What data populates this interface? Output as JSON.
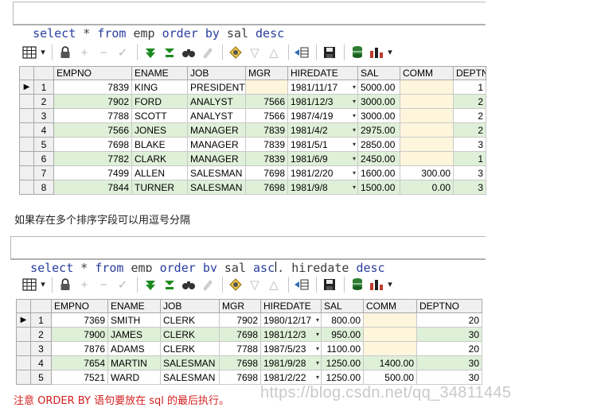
{
  "query1": {
    "tokens": [
      "select",
      "*",
      "from",
      "emp",
      "order",
      "by",
      "sal",
      "desc"
    ]
  },
  "toolbar": {
    "grid_icon": "grid-icon",
    "dropdown_arrow": "▾",
    "icons": [
      "lock-icon",
      "add-row-icon",
      "delete-row-icon",
      "post-edit-icon",
      "filter-icon",
      "filter-clear-icon",
      "find-icon",
      "clear-icon",
      "query-by-example-icon",
      "sort-desc-icon",
      "sort-asc-icon",
      "export-icon",
      "save-icon",
      "db-icon",
      "chart-icon"
    ]
  },
  "grid1": {
    "columns": [
      "EMPNO",
      "ENAME",
      "JOB",
      "MGR",
      "HIREDATE",
      "SAL",
      "COMM",
      "DEPTNO"
    ],
    "rows": [
      {
        "n": "1",
        "empno": "7839",
        "ename": "KING",
        "job": "PRESIDENT",
        "mgr": "",
        "hiredate": "1981/11/17",
        "sal": "5000.00",
        "comm": "",
        "deptno": "1"
      },
      {
        "n": "2",
        "empno": "7902",
        "ename": "FORD",
        "job": "ANALYST",
        "mgr": "7566",
        "hiredate": "1981/12/3",
        "sal": "3000.00",
        "comm": "",
        "deptno": "2"
      },
      {
        "n": "3",
        "empno": "7788",
        "ename": "SCOTT",
        "job": "ANALYST",
        "mgr": "7566",
        "hiredate": "1987/4/19",
        "sal": "3000.00",
        "comm": "",
        "deptno": "2"
      },
      {
        "n": "4",
        "empno": "7566",
        "ename": "JONES",
        "job": "MANAGER",
        "mgr": "7839",
        "hiredate": "1981/4/2",
        "sal": "2975.00",
        "comm": "",
        "deptno": "2"
      },
      {
        "n": "5",
        "empno": "7698",
        "ename": "BLAKE",
        "job": "MANAGER",
        "mgr": "7839",
        "hiredate": "1981/5/1",
        "sal": "2850.00",
        "comm": "",
        "deptno": "3"
      },
      {
        "n": "6",
        "empno": "7782",
        "ename": "CLARK",
        "job": "MANAGER",
        "mgr": "7839",
        "hiredate": "1981/6/9",
        "sal": "2450.00",
        "comm": "",
        "deptno": "1"
      },
      {
        "n": "7",
        "empno": "7499",
        "ename": "ALLEN",
        "job": "SALESMAN",
        "mgr": "7698",
        "hiredate": "1981/2/20",
        "sal": "1600.00",
        "comm": "300.00",
        "deptno": "3"
      },
      {
        "n": "8",
        "empno": "7844",
        "ename": "TURNER",
        "job": "SALESMAN",
        "mgr": "7698",
        "hiredate": "1981/9/8",
        "sal": "1500.00",
        "comm": "0.00",
        "deptno": "3"
      }
    ]
  },
  "note_text": "如果存在多个排序字段可以用逗号分隔",
  "query2": {
    "tokens": [
      "select",
      "*",
      "from",
      "emp",
      "order",
      "by",
      "sal",
      "asc",
      ",",
      "hiredate",
      "desc"
    ]
  },
  "grid2": {
    "columns": [
      "EMPNO",
      "ENAME",
      "JOB",
      "MGR",
      "HIREDATE",
      "SAL",
      "COMM",
      "DEPTNO"
    ],
    "rows": [
      {
        "n": "1",
        "empno": "7369",
        "ename": "SMITH",
        "job": "CLERK",
        "mgr": "7902",
        "hiredate": "1980/12/17",
        "sal": "800.00",
        "comm": "",
        "deptno": "20"
      },
      {
        "n": "2",
        "empno": "7900",
        "ename": "JAMES",
        "job": "CLERK",
        "mgr": "7698",
        "hiredate": "1981/12/3",
        "sal": "950.00",
        "comm": "",
        "deptno": "30"
      },
      {
        "n": "3",
        "empno": "7876",
        "ename": "ADAMS",
        "job": "CLERK",
        "mgr": "7788",
        "hiredate": "1987/5/23",
        "sal": "1100.00",
        "comm": "",
        "deptno": "20"
      },
      {
        "n": "4",
        "empno": "7654",
        "ename": "MARTIN",
        "job": "SALESMAN",
        "mgr": "7698",
        "hiredate": "1981/9/28",
        "sal": "1250.00",
        "comm": "1400.00",
        "deptno": "30"
      },
      {
        "n": "5",
        "empno": "7521",
        "ename": "WARD",
        "job": "SALESMAN",
        "mgr": "7698",
        "hiredate": "1981/2/22",
        "sal": "1250.00",
        "comm": "500.00",
        "deptno": "30"
      }
    ]
  },
  "footer_text": "注意 ORDER BY 语句要放在 sql 的最后执行。",
  "watermark": "https://blog.csdn.net/qq_34811445",
  "colors": {
    "keyword": "#2a3d9e",
    "row_alt": "#dff0d8",
    "empty_cell": "#fdf5dc",
    "footer": "#d41f1f"
  }
}
